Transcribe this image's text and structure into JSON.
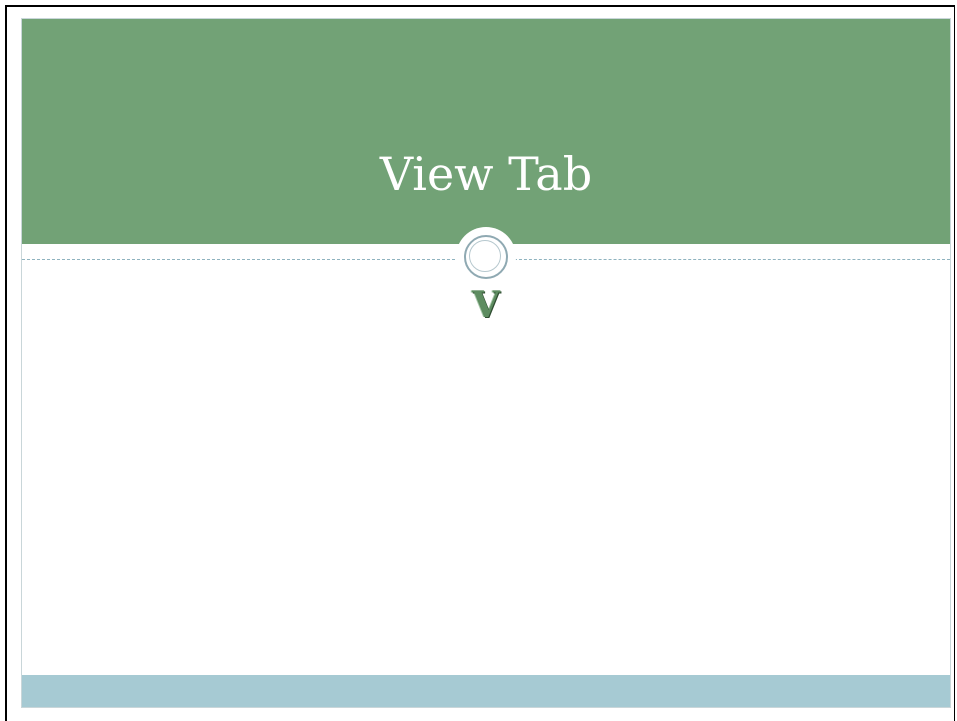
{
  "slide": {
    "title": "View Tab",
    "letter": "V",
    "colors": {
      "title_band": "#72a276",
      "footer_band": "#a6cad3",
      "title_text": "#ffffff",
      "letter": "#5d8c60"
    },
    "ornament_icon": "circle-ornament-icon"
  }
}
